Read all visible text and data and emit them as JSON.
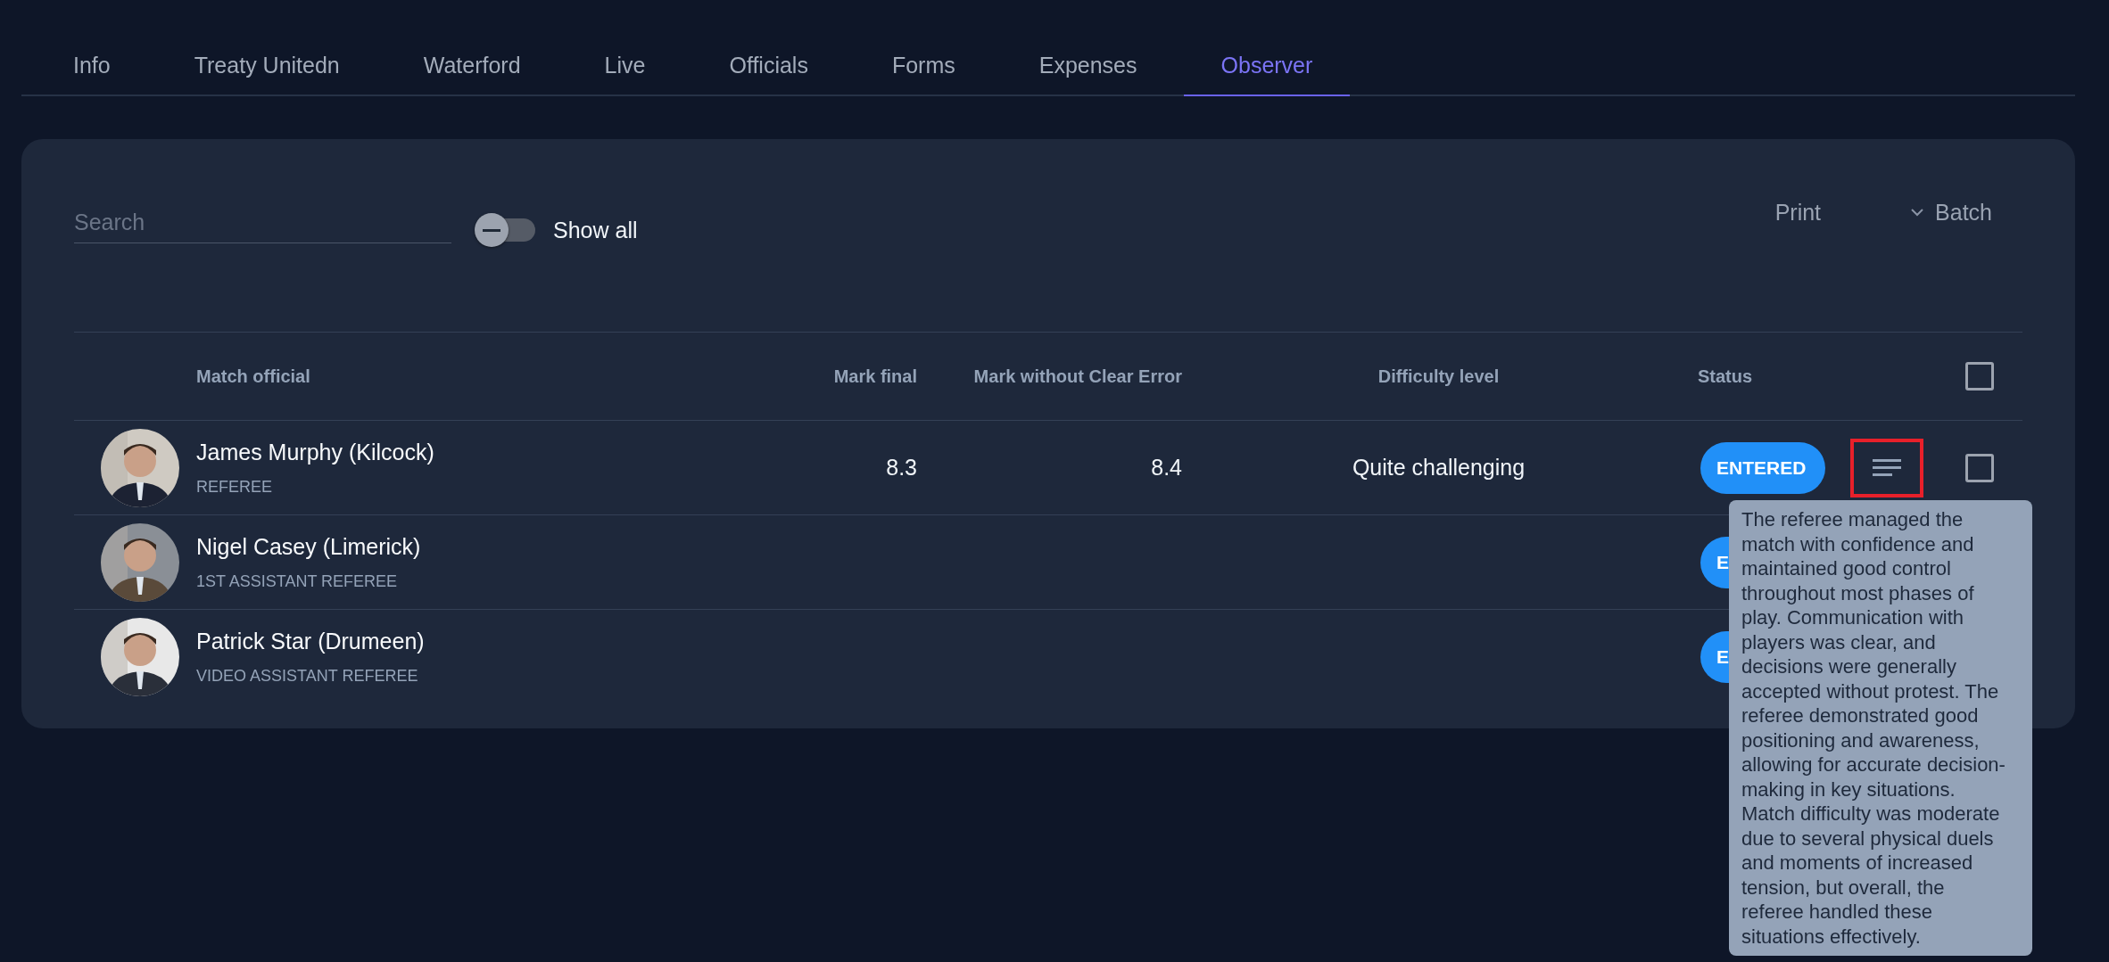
{
  "tabs": [
    {
      "label": "Info",
      "selected": false
    },
    {
      "label": "Treaty Unitedn",
      "selected": false
    },
    {
      "label": "Waterford",
      "selected": false
    },
    {
      "label": "Live",
      "selected": false
    },
    {
      "label": "Officials",
      "selected": false
    },
    {
      "label": "Forms",
      "selected": false
    },
    {
      "label": "Expenses",
      "selected": false
    },
    {
      "label": "Observer",
      "selected": true
    }
  ],
  "search": {
    "placeholder": "Search"
  },
  "show_all": {
    "label": "Show all",
    "on": false
  },
  "actions": {
    "print": "Print",
    "batch": "Batch"
  },
  "table": {
    "columns": [
      "Match official",
      "Mark final",
      "Mark without Clear Error",
      "Difficulty level",
      "Status"
    ],
    "header_checked": false,
    "rows": [
      {
        "name": "James Murphy (Kilcock)",
        "role": "REFEREE",
        "mark_final": "8.3",
        "mark_without_clear_error": "8.4",
        "difficulty": "Quite challenging",
        "status": "ENTERED",
        "notes_highlighted": true,
        "checked": false
      },
      {
        "name": "Nigel Casey (Limerick)",
        "role": "1ST ASSISTANT REFEREE",
        "status": "E"
      },
      {
        "name": "Patrick Star (Drumeen)",
        "role": "VIDEO ASSISTANT REFEREE",
        "status": "E"
      }
    ]
  },
  "tooltip": {
    "text": "The referee managed the match with confidence and maintained good control throughout most phases of play. Communication with players was clear, and decisions were generally accepted without protest. The referee demonstrated good positioning and awareness, allowing for accurate decision-making in key situations. Match difficulty was moderate due to several physical duels and moments of increased tension, but overall, the referee handled these situations effectively."
  }
}
